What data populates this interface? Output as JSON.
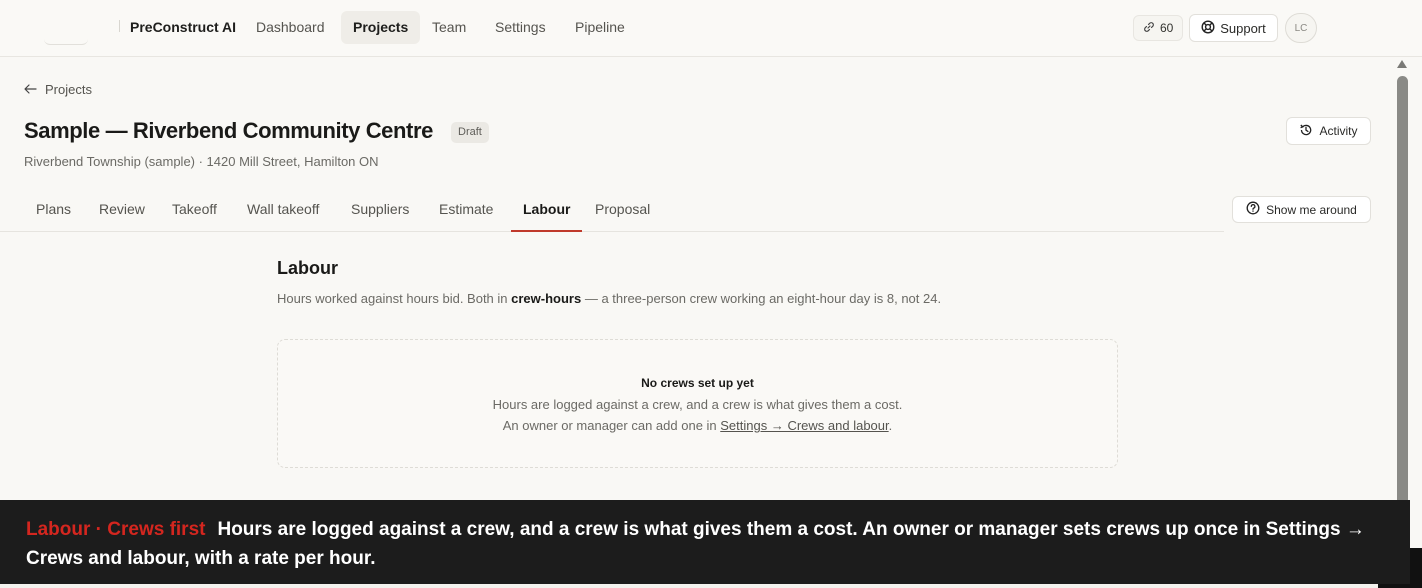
{
  "nav": {
    "brand": "PreConstruct AI",
    "items": [
      {
        "label": "Dashboard",
        "active": false
      },
      {
        "label": "Projects",
        "active": true
      },
      {
        "label": "Team",
        "active": false
      },
      {
        "label": "Settings",
        "active": false
      },
      {
        "label": "Pipeline",
        "active": false
      }
    ],
    "credits": "60",
    "credits_icon": "link-icon",
    "support_label": "Support",
    "support_icon": "lifebuoy-icon",
    "avatar_initials": "LC"
  },
  "header": {
    "back_label": "Projects",
    "title": "Sample — Riverbend Community Centre",
    "status_badge": "Draft",
    "address": "Riverbend Township (sample) · 1420 Mill Street, Hamilton ON",
    "activity_label": "Activity"
  },
  "tabs": [
    {
      "label": "Plans",
      "active": false
    },
    {
      "label": "Review",
      "active": false
    },
    {
      "label": "Takeoff",
      "active": false
    },
    {
      "label": "Wall takeoff",
      "active": false
    },
    {
      "label": "Suppliers",
      "active": false
    },
    {
      "label": "Estimate",
      "active": false
    },
    {
      "label": "Labour",
      "active": true
    },
    {
      "label": "Proposal",
      "active": false
    }
  ],
  "tour_label": "Show me around",
  "labour": {
    "title": "Labour",
    "desc_before": "Hours worked against hours bid. Both in ",
    "desc_strong": "crew-hours",
    "desc_after": " — a three-person crew working an eight-hour day is 8, not 24.",
    "empty_title": "No crews set up yet",
    "empty_line1": "Hours are logged against a crew, and a crew is what gives them a cost.",
    "empty_line2_before": "An owner or manager can add one in ",
    "empty_line2_link": "Settings → Crews and labour",
    "empty_line2_after": "."
  },
  "caption": {
    "tag": "Labour · Crews first",
    "text": "Hours are logged against a crew, and a crew is what gives them a cost. An owner or manager sets crews up once in Settings → Crews and labour, with a rate per hour."
  },
  "colors": {
    "accent": "#c0392b",
    "caption_tag": "#d4261f",
    "caption_bg": "#1c1c1c",
    "page_bg": "#f9f8f5"
  }
}
